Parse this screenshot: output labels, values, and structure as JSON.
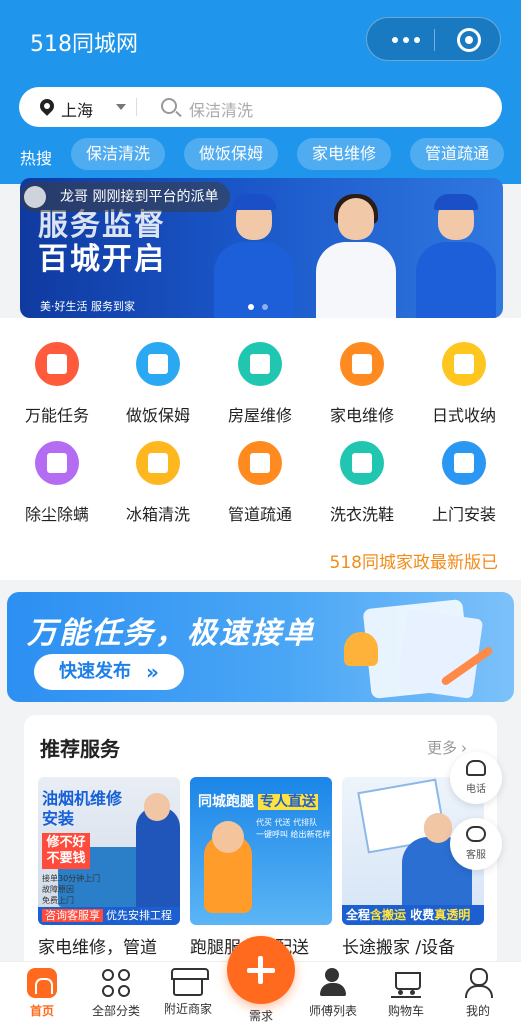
{
  "header": {
    "title": "518同城网",
    "bg_color": "#1f95ec",
    "menu_icon": "more-dots-icon",
    "close_icon": "target-circle-icon"
  },
  "search": {
    "city": "上海",
    "placeholder": "保洁清洗"
  },
  "hot": {
    "label": "热搜",
    "tags": [
      "保洁清洗",
      "做饭保姆",
      "家电维修",
      "管道疏通"
    ]
  },
  "banner": {
    "toast": "龙哥 刚刚接到平台的派单",
    "line1": "服务监督",
    "line2": "百城开启",
    "slogan": "美·好生活  服务到家",
    "dots_total": 2,
    "dots_active": 1
  },
  "services": [
    {
      "label": "万能任务",
      "icon": "broom-icon",
      "color": "#ff5a3c"
    },
    {
      "label": "做饭保姆",
      "icon": "pot-icon",
      "color": "#2aa9f2"
    },
    {
      "label": "房屋维修",
      "icon": "house-icon",
      "color": "#20c6b0"
    },
    {
      "label": "家电维修",
      "icon": "tv-icon",
      "color": "#ff8a1f"
    },
    {
      "label": "日式收纳",
      "icon": "storage-box-icon",
      "color": "#ffc61f"
    },
    {
      "label": "除尘除螨",
      "icon": "mite-icon",
      "color": "#b46cf2"
    },
    {
      "label": "冰箱清洗",
      "icon": "fridge-icon",
      "color": "#ffb71f"
    },
    {
      "label": "管道疏通",
      "icon": "pipe-icon",
      "color": "#ff8a1f"
    },
    {
      "label": "洗衣洗鞋",
      "icon": "washer-icon",
      "color": "#20c6b0"
    },
    {
      "label": "上门安装",
      "icon": "drill-icon",
      "color": "#2a97f2"
    }
  ],
  "version_note": "518同城家政最新版已",
  "promo": {
    "title": "万能任务，极速接单",
    "button": "快速发布",
    "button_arrow": "»"
  },
  "recommend": {
    "title": "推荐服务",
    "more": "更多",
    "more_arrow": "›",
    "cards": [
      {
        "caption": "家电维修，管道",
        "img_title": "油烟机维修\n安装",
        "img_badge": "修不好\n不要钱",
        "img_note": "接单30分钟上门\n故障原因\n免费上门",
        "img_bar_tag": "咨询客服享",
        "img_bar": "优先安排工程师"
      },
      {
        "caption": "跑腿服务，配送",
        "img_title": "同城跑腿",
        "img_title_tag": "专人直送",
        "img_sub": "代买 代送 代排队\n一键呼叫 给出新花样"
      },
      {
        "caption": "长途搬家 /设备",
        "img_bar_a": "全程",
        "img_bar_b": "含搬运",
        "img_bar_c": " 收费",
        "img_bar_d": "真透明"
      }
    ]
  },
  "floating": {
    "phone": "电话",
    "service": "客服"
  },
  "tabbar": {
    "items": [
      {
        "label": "首页",
        "icon": "home-icon",
        "active": true
      },
      {
        "label": "全部分类",
        "icon": "categories-icon"
      },
      {
        "label": "附近商家",
        "icon": "shop-icon"
      },
      {
        "label": "需求",
        "icon": "plus-icon"
      },
      {
        "label": "师傅列表",
        "icon": "workers-icon"
      },
      {
        "label": "购物车",
        "icon": "cart-icon"
      },
      {
        "label": "我的",
        "icon": "user-icon"
      }
    ],
    "accent_color": "#ff6a1f"
  }
}
